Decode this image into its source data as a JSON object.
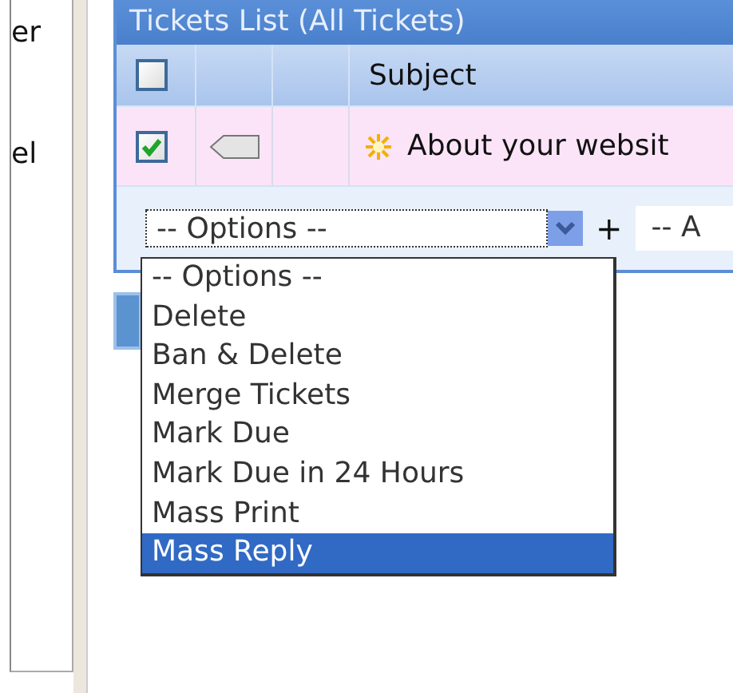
{
  "sidebar": {
    "items": [
      {
        "label": "er"
      },
      {
        "label": "el"
      }
    ]
  },
  "panel": {
    "title": "Tickets List (All Tickets)",
    "select_all": {
      "checked": false
    },
    "columns": [
      "Subject"
    ],
    "rows": [
      {
        "checked": true,
        "subject": "About your websit"
      }
    ]
  },
  "actions": {
    "select": {
      "value": "-- Options --",
      "expanded": true
    },
    "plus": "+",
    "select_2": {
      "value": "-- A"
    },
    "options": [
      {
        "label": "-- Options --",
        "selected": false
      },
      {
        "label": "Delete",
        "selected": false
      },
      {
        "label": "Ban & Delete",
        "selected": false
      },
      {
        "label": "Merge Tickets",
        "selected": false
      },
      {
        "label": "Mark Due",
        "selected": false
      },
      {
        "label": "Mark Due in 24 Hours",
        "selected": false
      },
      {
        "label": "Mass Print",
        "selected": false
      },
      {
        "label": "Mass Reply",
        "selected": true
      }
    ]
  }
}
